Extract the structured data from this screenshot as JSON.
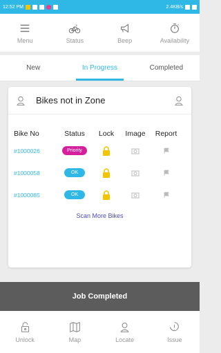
{
  "status_bar": {
    "time": "12:52 PM",
    "network": "2.4KB/s"
  },
  "toolbar": [
    {
      "label": "Menu",
      "icon": "hamburger-icon"
    },
    {
      "label": "Status",
      "icon": "bike-icon"
    },
    {
      "label": "Beep",
      "icon": "horn-icon"
    },
    {
      "label": "Availability",
      "icon": "timer-icon"
    }
  ],
  "tabs": [
    "New",
    "In Progress",
    "Completed"
  ],
  "active_tab": "In Progress",
  "card": {
    "title": "Bikes not in Zone",
    "columns": [
      "Bike No",
      "Status",
      "Lock",
      "Image",
      "Report"
    ],
    "rows": [
      {
        "bike_no": "#1000026",
        "status": "Priority"
      },
      {
        "bike_no": "#1000058",
        "status": "OK"
      },
      {
        "bike_no": "#1000085",
        "status": "OK"
      }
    ],
    "scan_more": "Scan More Bikes"
  },
  "job_completed": "Job Completed",
  "bottom_nav": [
    {
      "label": "Unlock",
      "icon": "padlock-open-icon"
    },
    {
      "label": "Map",
      "icon": "map-icon"
    },
    {
      "label": "Locate",
      "icon": "person-pin-icon"
    },
    {
      "label": "Issue",
      "icon": "issue-icon"
    }
  ],
  "colors": {
    "accent": "#2fb8e6",
    "priority": "#d61f9b",
    "lock": "#f5c400",
    "job_bar": "#5c5c5c"
  }
}
